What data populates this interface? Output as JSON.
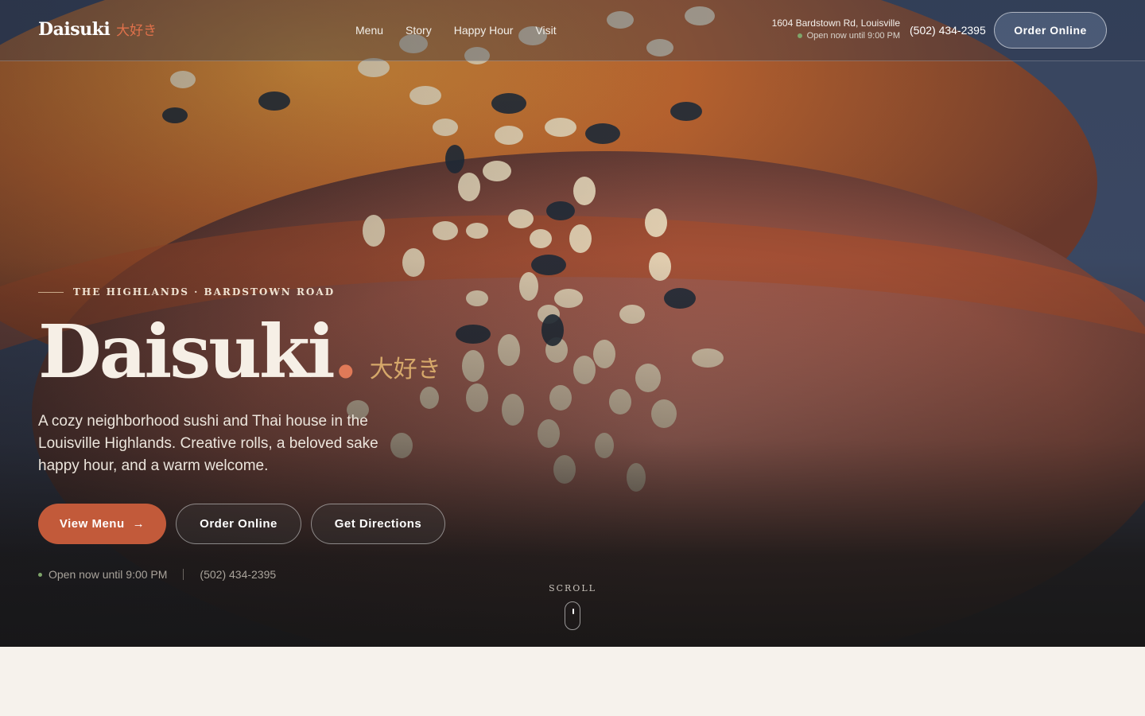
{
  "nav": {
    "brand_name": "Daisuki",
    "brand_kanji": "大好き",
    "links": [
      "Menu",
      "Story",
      "Happy Hour",
      "Visit"
    ],
    "address": "1604 Bardstown Rd, Louisville",
    "hours": "Open now until 9:00 PM",
    "phone": "(502) 434-2395",
    "order_label": "Order Online"
  },
  "hero": {
    "eyebrow": "THE HIGHLANDS · BARDSTOWN ROAD",
    "headline": "Daisuki",
    "headline_dot": ".",
    "headline_kanji": "大好き",
    "lede": "A cozy neighborhood sushi and Thai house in the Louisville Highlands. Creative rolls, a beloved sake happy hour, and a warm welcome.",
    "primary_button": "View Menu",
    "primary_arrow": "→",
    "order_button": "Order Online",
    "directions_button": "Get Directions",
    "status_hours": "Open now until 9:00 PM",
    "status_phone": "(502) 434-2395",
    "scroll_label": "SCROLL"
  },
  "colors": {
    "accent": "#c25a3a",
    "kanji": "#e0714b",
    "open_dot": "#7fa56a",
    "cream": "#f6f2ec"
  },
  "icons": {
    "open_indicator": "green-dot-icon",
    "arrow": "arrow-right-icon",
    "scroll": "mouse-icon"
  }
}
